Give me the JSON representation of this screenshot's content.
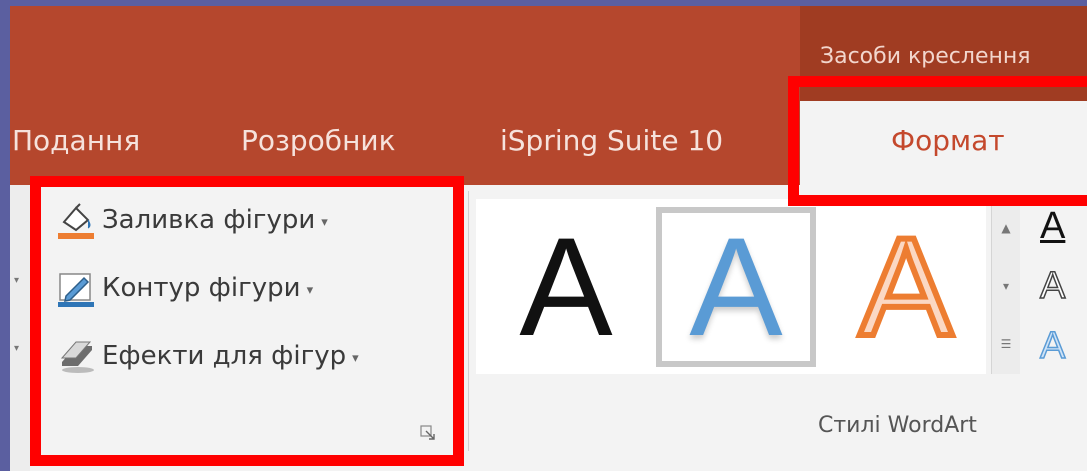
{
  "ribbon": {
    "contextual_group": "Засоби креслення",
    "tabs": [
      {
        "label": "Подання"
      },
      {
        "label": "Розробник"
      },
      {
        "label": "iSpring Suite 10"
      },
      {
        "label": "Формат",
        "selected": true
      }
    ]
  },
  "shape_styles": {
    "commands": [
      {
        "label": "Заливка фігури",
        "icon": "paint-bucket-icon"
      },
      {
        "label": "Контур фігури",
        "icon": "pencil-outline-icon"
      },
      {
        "label": "Ефекти для фігур",
        "icon": "shape-effects-icon"
      }
    ],
    "caret": "▾"
  },
  "wordart": {
    "group_label": "Стилі WordArt",
    "gallery": [
      {
        "glyph": "A",
        "style": "plain-black"
      },
      {
        "glyph": "A",
        "style": "blue-shadow",
        "selected": true
      },
      {
        "glyph": "A",
        "style": "orange-outline"
      }
    ],
    "side_glyphs": [
      "A",
      "A",
      "A"
    ]
  },
  "colors": {
    "ribbon_bg": "#b5472d",
    "contextual_bg": "#a03c22",
    "highlight": "#ff0000",
    "fill_accent": "#ed7d31",
    "outline_accent": "#2e75b6"
  }
}
